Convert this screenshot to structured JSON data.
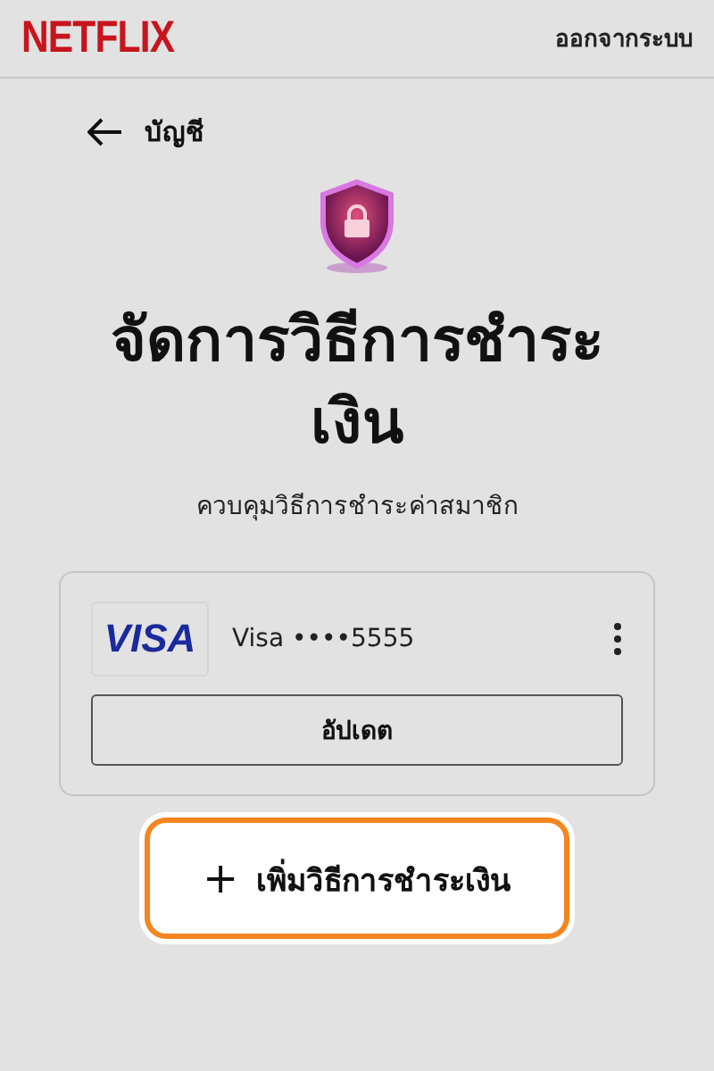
{
  "header": {
    "logo": "NETFLIX",
    "sign_out": "ออกจากระบบ"
  },
  "back_link": {
    "label": "บัญชี"
  },
  "title": "จัดการวิธีการชำระเงิน",
  "subtitle": "ควบคุมวิธีการชำระค่าสมาชิก",
  "payment_methods": [
    {
      "brand_logo": "VISA",
      "label": "Visa ••••5555",
      "update_button": "อัปเดต"
    }
  ],
  "add_button": {
    "icon": "+",
    "label": "เพิ่มวิธีการชำระเงิน",
    "highlighted": true
  }
}
